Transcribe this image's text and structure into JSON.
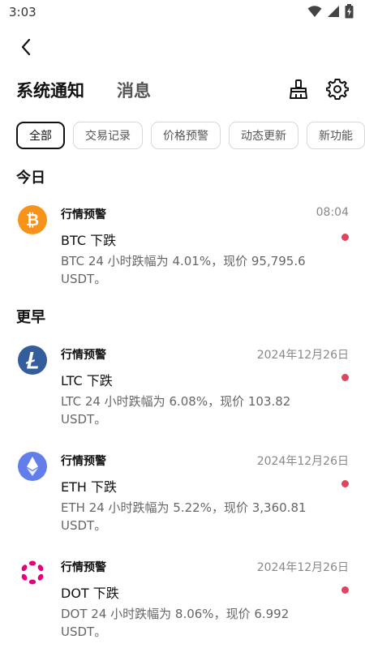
{
  "status": {
    "time": "3:03"
  },
  "header": {
    "tabs": [
      {
        "label": "系统通知"
      },
      {
        "label": "消息"
      }
    ]
  },
  "filters": [
    {
      "label": "全部"
    },
    {
      "label": "交易记录"
    },
    {
      "label": "价格预警"
    },
    {
      "label": "动态更新"
    },
    {
      "label": "新功能"
    }
  ],
  "sections": {
    "today": "今日",
    "earlier": "更早"
  },
  "notifications": [
    {
      "category": "行情预警",
      "time": "08:04",
      "title": "BTC 下跌",
      "body": "BTC 24 小时跌幅为 4.01%，现价 95,795.6 USDT。",
      "icon": "bitcoin-icon",
      "color": "#f7931a"
    },
    {
      "category": "行情预警",
      "time": "2024年12月26日",
      "title": "LTC 下跌",
      "body": "LTC 24 小时跌幅为 6.08%，现价 103.82 USDT。",
      "icon": "litecoin-icon",
      "color": "#345d9d"
    },
    {
      "category": "行情预警",
      "time": "2024年12月26日",
      "title": "ETH 下跌",
      "body": "ETH 24 小时跌幅为 5.22%，现价 3,360.81 USDT。",
      "icon": "ethereum-icon",
      "color": "#627eea"
    },
    {
      "category": "行情预警",
      "time": "2024年12月26日",
      "title": "DOT 下跌",
      "body": "DOT 24 小时跌幅为 8.06%，现价 6.992 USDT。",
      "icon": "polkadot-icon",
      "color": "#e6007a"
    }
  ],
  "colors": {
    "unread_dot": "#e0445f",
    "accent": "#111111"
  }
}
